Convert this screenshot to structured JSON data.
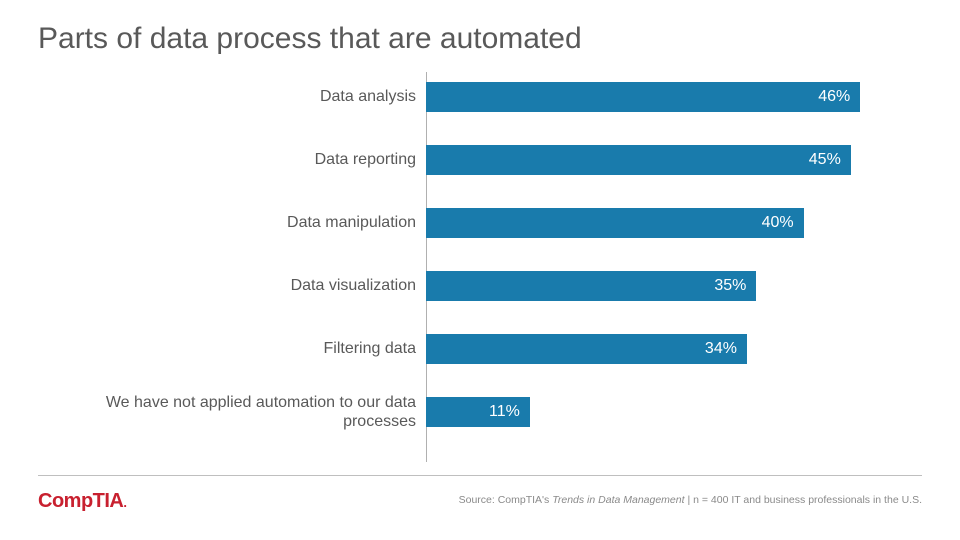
{
  "title": "Parts of data process that are automated",
  "logo_main": "CompTIA",
  "logo_tail": ".",
  "source_prefix": "Source: CompTIA's ",
  "source_italic": "Trends in Data Management",
  "source_suffix": " | n = 400 IT and business professionals in the U.S.",
  "chart_data": {
    "type": "bar",
    "orientation": "horizontal",
    "categories": [
      "Data analysis",
      "Data reporting",
      "Data manipulation",
      "Data visualization",
      "Filtering data",
      "We have not applied automation to our data processes"
    ],
    "values": [
      46,
      45,
      40,
      35,
      34,
      11
    ],
    "value_labels": [
      "46%",
      "45%",
      "40%",
      "35%",
      "34%",
      "11%"
    ],
    "xlim": [
      0,
      50
    ],
    "bar_color": "#197bac",
    "title": "Parts of data process that are automated",
    "xlabel": "",
    "ylabel": ""
  }
}
